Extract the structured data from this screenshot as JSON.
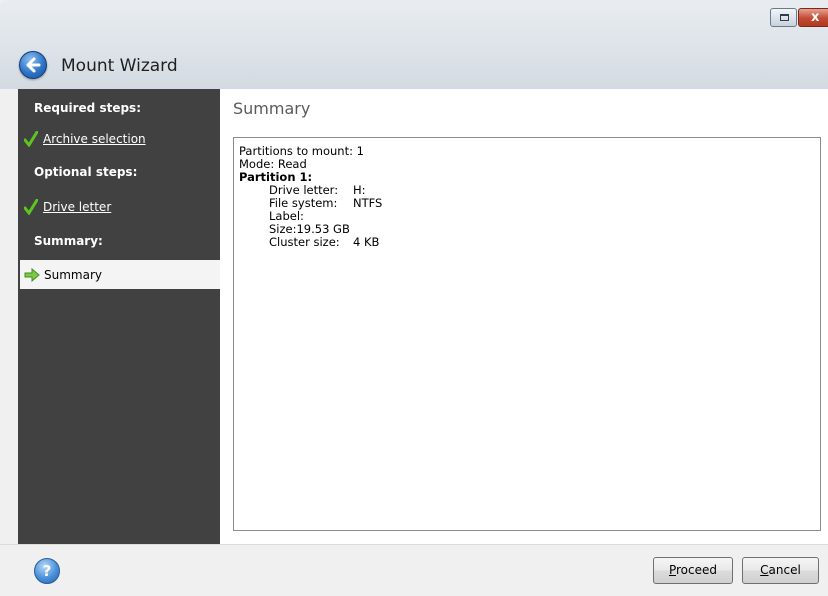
{
  "window": {
    "title": "Mount Wizard",
    "close_glyph": "x"
  },
  "sidebar": {
    "required_heading": "Required steps:",
    "archive_selection": "Archive selection",
    "optional_heading": "Optional steps:",
    "drive_letter": "Drive letter",
    "summary_heading": "Summary:",
    "summary_item": "Summary"
  },
  "main": {
    "title": "Summary",
    "summary": {
      "partitions_to_mount": "Partitions to mount: 1",
      "mode": "Mode: Read",
      "partition_heading": "Partition 1:",
      "drive_letter_key": "Drive letter:",
      "drive_letter_val": "H:",
      "file_system_key": "File system:",
      "file_system_val": "NTFS",
      "label_key": "Label:",
      "size": "Size:19.53 GB",
      "cluster_key": "Cluster size:",
      "cluster_val": "4 KB"
    }
  },
  "footer": {
    "help_glyph": "?",
    "proceed_first": "P",
    "proceed_rest": "roceed",
    "cancel_first": "C",
    "cancel_rest": "ancel"
  },
  "icons": {
    "back": "back-arrow-icon",
    "help": "help-icon",
    "check": "check-icon",
    "current_step": "green-arrow-icon"
  },
  "colors": {
    "sidebar_bg": "#414141",
    "check_green": "#5cc51e",
    "accent_blue": "#2e74c7"
  }
}
